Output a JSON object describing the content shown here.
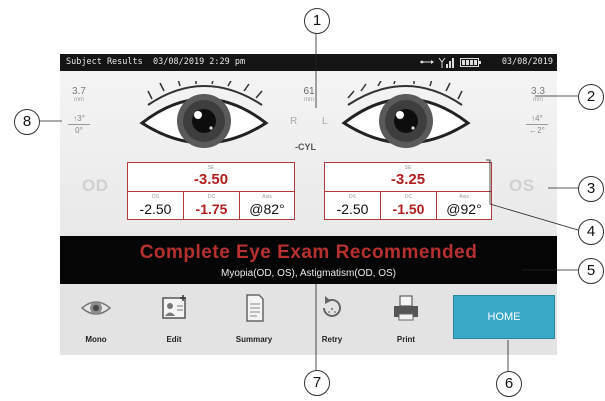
{
  "status_bar": {
    "title": "Subject Results",
    "datetime": "03/08/2019 2:29 pm",
    "date": "03/08/2019",
    "icons": [
      "usb-icon",
      "signal-icon",
      "battery-icon"
    ]
  },
  "pupil_distance": {
    "value": "61",
    "unit": "mm"
  },
  "right_eye": {
    "side_label": "OD",
    "pupil_size": "3.7",
    "pupil_unit": "mm",
    "gaze_vertical": "↑3°",
    "gaze_horizontal": "0°",
    "se_label": "SE",
    "se": "-3.50",
    "ds_label": "DS",
    "ds": "-2.50",
    "dc_label": "DC",
    "dc": "-1.75",
    "axis_label": "Axis",
    "axis": "@82°"
  },
  "left_eye": {
    "side_label": "OS",
    "pupil_size": "3.3",
    "pupil_unit": "mm",
    "gaze_vertical": "↑4°",
    "gaze_horizontal": "←2°",
    "se_label": "SE",
    "se": "-3.25",
    "ds_label": "DS",
    "ds": "-2.50",
    "dc_label": "DC",
    "dc": "-1.50",
    "axis_label": "Axis",
    "axis": "@92°"
  },
  "eye_labels": {
    "right": "R",
    "left": "L"
  },
  "cyl_label": "-CYL",
  "banner": {
    "message": "Complete Eye Exam Recommended",
    "diagnosis": "Myopia(OD, OS), Astigmatism(OD, OS)"
  },
  "toolbar": {
    "mono": "Mono",
    "edit": "Edit",
    "summary": "Summary",
    "retry": "Retry",
    "print": "Print",
    "home": "HOME"
  },
  "callouts": [
    "1",
    "2",
    "3",
    "4",
    "5",
    "6",
    "7",
    "8"
  ],
  "colors": {
    "accent_red": "#b01e1e",
    "home_button": "#3aa9c9",
    "banner_bg": "#050505"
  }
}
